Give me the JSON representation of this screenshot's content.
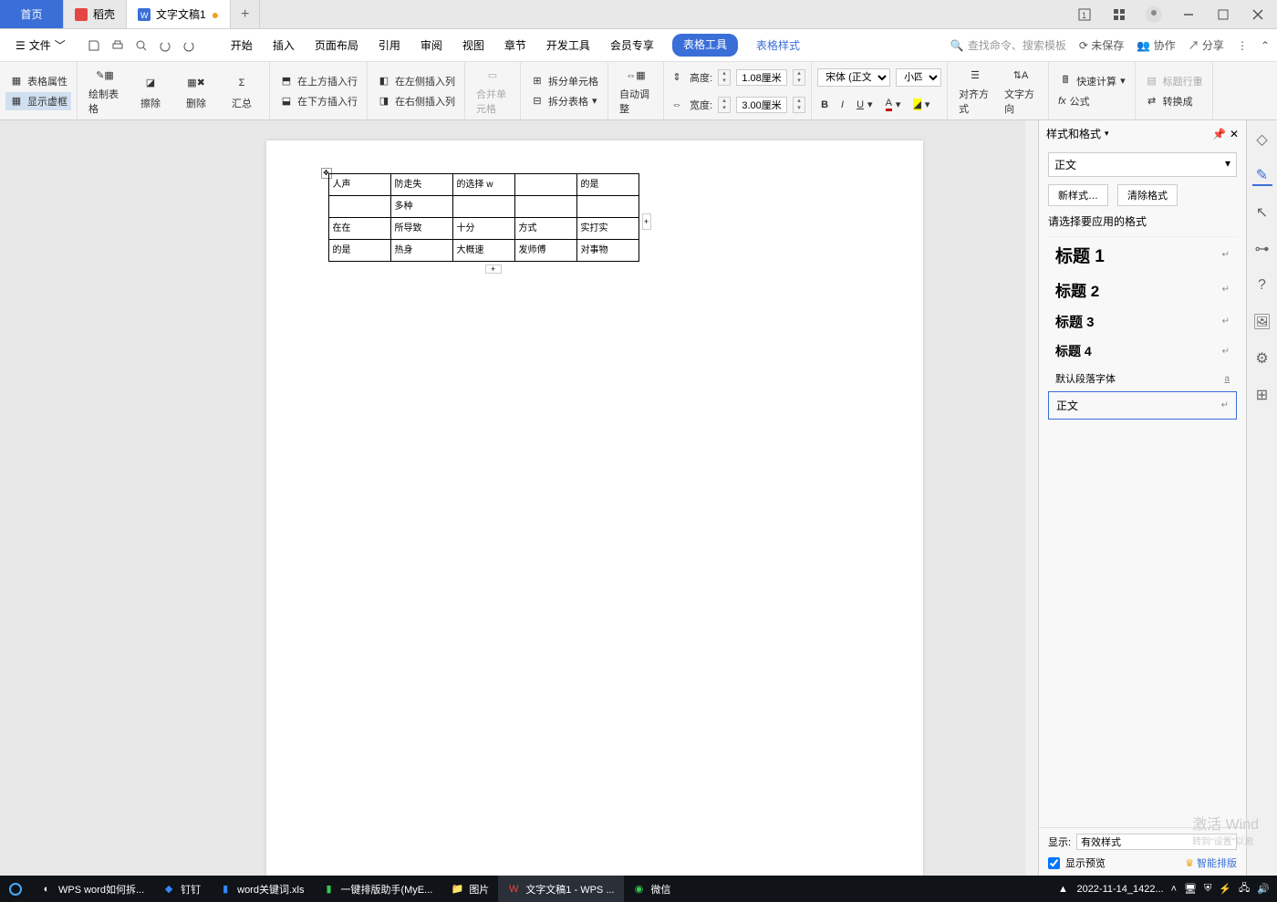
{
  "tabs": {
    "home": "首页",
    "daoke": "稻壳",
    "doc": "文字文稿1"
  },
  "menubar": {
    "file": "文件",
    "items": [
      "开始",
      "插入",
      "页面布局",
      "引用",
      "审阅",
      "视图",
      "章节",
      "开发工具",
      "会员专享",
      "表格工具",
      "表格样式"
    ],
    "search_placeholder": "查找命令、搜索模板",
    "unsaved": "未保存",
    "collab": "协作",
    "share": "分享"
  },
  "ribbon": {
    "table_props": "表格属性",
    "show_frame": "显示虚框",
    "draw_table": "绘制表格",
    "eraser": "擦除",
    "delete": "删除",
    "summary": "汇总",
    "ins_above": "在上方插入行",
    "ins_below": "在下方插入行",
    "ins_left": "在左侧插入列",
    "ins_right": "在右侧插入列",
    "merge": "合并单元格",
    "split_cell": "拆分单元格",
    "split_table": "拆分表格",
    "autofit": "自动调整",
    "height_lbl": "高度:",
    "height_val": "1.08厘米",
    "width_lbl": "宽度:",
    "width_val": "3.00厘米",
    "font_name": "宋体 (正文)",
    "font_size": "小四",
    "align": "对齐方式",
    "text_dir": "文字方向",
    "quick_calc": "快速计算",
    "formula": "公式",
    "title_row": "标题行重",
    "convert": "转换成"
  },
  "table": {
    "rows": [
      [
        "人声",
        "防走失",
        "的选择 w",
        "",
        "的是"
      ],
      [
        "",
        "多种",
        "",
        "",
        ""
      ],
      [
        "在在",
        "所导致",
        "十分",
        "方式",
        "实打实"
      ],
      [
        "的是",
        "热身",
        "大概速",
        "发师傅",
        "对事物"
      ]
    ]
  },
  "style_panel": {
    "title": "样式和格式",
    "current": "正文",
    "new_btn": "新样式…",
    "clear_btn": "清除格式",
    "prompt": "请选择要应用的格式",
    "items": [
      "标题 1",
      "标题 2",
      "标题 3",
      "标题 4",
      "默认段落字体",
      "正文"
    ],
    "show_label": "显示:",
    "show_value": "有效样式",
    "preview": "显示预览",
    "smart": "智能排版"
  },
  "watermark": {
    "l1": "激活 Wind",
    "l2": "转到\"设置\"以激"
  },
  "taskbar": {
    "items": [
      "WPS word如何拆...",
      "钉钉",
      "word关键词.xls",
      "一键排版助手(MyE...",
      "图片",
      "文字文稿1 - WPS ...",
      "微信"
    ],
    "clock": "2022-11-14_1422..."
  }
}
